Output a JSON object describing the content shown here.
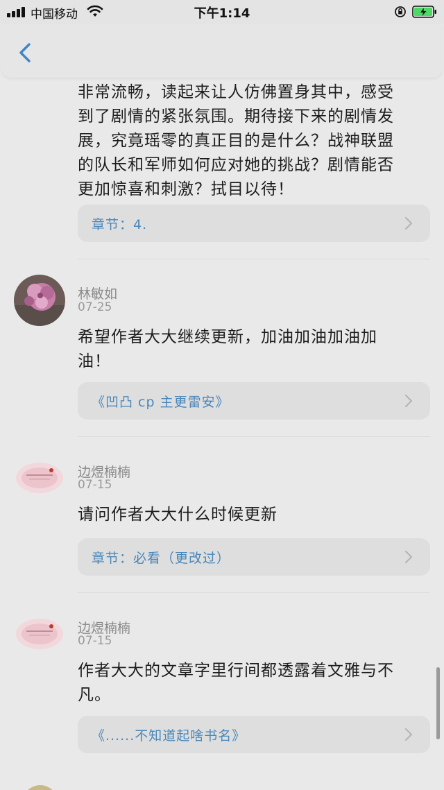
{
  "status_bar": {
    "carrier": "中国移动",
    "time": "下午1:14"
  },
  "nav": {
    "back_icon": "chevron-left-icon"
  },
  "comments": [
    {
      "text": "非常流畅，读起来让人仿佛置身其中，感受到了剧情的紧张氛围。期待接下来的剧情发展，究竟瑶零的真正目的是什么？战神联盟的队长和军师如何应对她的挑战？剧情能否更加惊喜和刺激？拭目以待！",
      "lines": [
        "非常流畅，读起来让人仿佛置身其中，感受",
        "到了剧情的紧张氛围。期待接下来的剧情发",
        "展，究竟瑶零的真正目的是什么？战神联盟",
        "的队长和军师如何应对她的挑战？剧情能否",
        "更加惊喜和刺激？拭目以待！"
      ],
      "ref": "章节：4."
    },
    {
      "user": "林敏如",
      "date": "07-25",
      "lines": [
        "希望作者大大继续更新，加油加油加油加",
        "油！"
      ],
      "ref": "《凹凸 cp 主更雷安》"
    },
    {
      "user": "边煜楠楠",
      "date": "07-15",
      "lines": [
        "请问作者大大什么时候更新"
      ],
      "ref": "章节：必看（更改过）"
    },
    {
      "user": "边煜楠楠",
      "date": "07-15",
      "lines": [
        "作者大大的文章字里行间都透露着文雅与不",
        "凡。"
      ],
      "ref": "《......不知道起啥书名》"
    }
  ],
  "colors": {
    "accent": "#4a87ba",
    "background": "#e9e9e9",
    "card": "#dedede"
  }
}
